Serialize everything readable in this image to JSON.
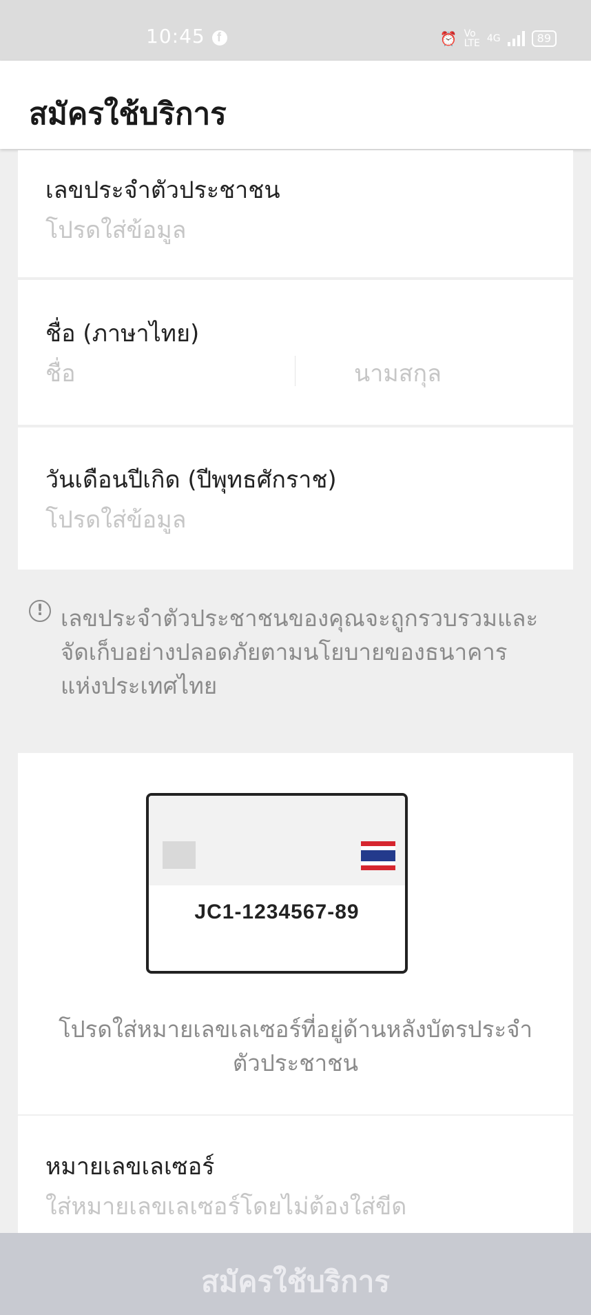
{
  "status_bar": {
    "time": "10:45",
    "battery": "89",
    "network": "4G"
  },
  "header": {
    "title": "สมัครใช้บริการ"
  },
  "fields": {
    "citizen_id": {
      "label": "เลขประจำตัวประชาชน",
      "placeholder": "โปรดใส่ข้อมูล"
    },
    "name_thai": {
      "label": "ชื่อ (ภาษาไทย)",
      "first_placeholder": "ชื่อ",
      "last_placeholder": "นามสกุล"
    },
    "birth_date": {
      "label": "วันเดือนปีเกิด (ปีพุทธศักราช)",
      "placeholder": "โปรดใส่ข้อมูล"
    },
    "laser_id": {
      "label": "หมายเลขเลเซอร์",
      "placeholder": "ใส่หมายเลขเลเซอร์โดยไม่ต้องใส่ขีด"
    }
  },
  "info": {
    "line1": "เลขประจำตัวประชาชนของคุณจะถูกรวบรวมและ",
    "line2": "จัดเก็บอย่างปลอดภัยตามนโยบายของธนาคาร",
    "line3": "แห่งประเทศไทย"
  },
  "id_card": {
    "sample_number": "JC1-1234567-89",
    "caption_line1": "โปรดใส่หมายเลขเลเซอร์ที่อยู่ด้านหลังบัตรประจำ",
    "caption_line2": "ตัวประชาชน"
  },
  "submit": {
    "label": "สมัครใช้บริการ"
  },
  "colors": {
    "accent_disabled": "#c8cad1",
    "placeholder": "#c6c6c6",
    "flag_red": "#d6262f",
    "flag_blue": "#233a8c"
  }
}
